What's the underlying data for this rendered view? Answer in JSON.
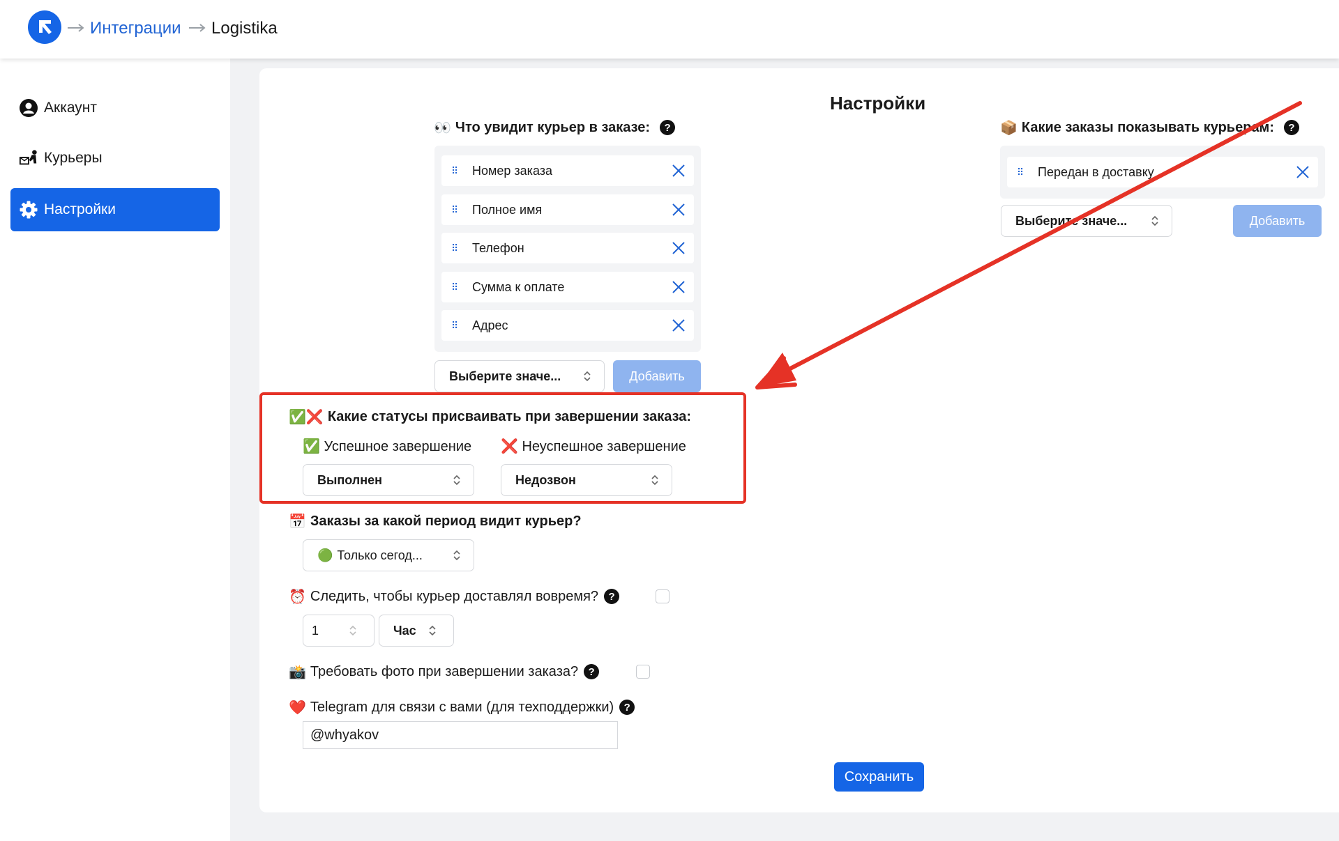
{
  "header": {
    "breadcrumb": [
      "Интеграции",
      "Logistika"
    ]
  },
  "sidebar": {
    "items": [
      {
        "label": "Аккаунт",
        "icon": "user-circle-icon",
        "active": false
      },
      {
        "label": "Курьеры",
        "icon": "courier-icon",
        "active": false
      },
      {
        "label": "Настройки",
        "icon": "gear-icon",
        "active": true
      }
    ]
  },
  "main": {
    "title": "Настройки",
    "courier_fields": {
      "label": "Что увидит курьер в заказе:",
      "emoji": "👀",
      "items": [
        "Номер заказа",
        "Полное имя",
        "Телефон",
        "Сумма к оплате",
        "Адрес"
      ],
      "select_placeholder": "Выберите значе...",
      "add_label": "Добавить"
    },
    "orders_show": {
      "label": "Какие заказы показывать курьерам:",
      "emoji": "📦",
      "items": [
        "Передан в доставку"
      ],
      "select_placeholder": "Выберите значе...",
      "add_label": "Добавить"
    },
    "statuses": {
      "label": "Какие статусы присваивать при завершении заказа:",
      "emoji": "✅❌",
      "success_label": "Успешное завершение",
      "success_emoji": "✅",
      "success_value": "Выполнен",
      "fail_label": "Неуспешное завершение",
      "fail_emoji": "❌",
      "fail_value": "Недозвон"
    },
    "period": {
      "label": "Заказы за какой период видит курьер?",
      "emoji": "📅",
      "value": "Только сегод...",
      "value_emoji": "🟢"
    },
    "on_time": {
      "label": "Следить, чтобы курьер доставлял вовремя?",
      "emoji": "⏰",
      "checked": false,
      "amount": "1",
      "unit": "Час"
    },
    "photo": {
      "label": "Требовать фото при завершении заказа?",
      "emoji": "📸",
      "checked": false
    },
    "telegram": {
      "label": "Telegram для связи с вами (для техподдержки)",
      "emoji": "❤️",
      "value": "@whyakov"
    },
    "save_label": "Сохранить"
  },
  "colors": {
    "accent": "#1565e6",
    "disabled_button": "#8fb4ef",
    "annotation": "#e53226"
  },
  "help_glyph": "?"
}
